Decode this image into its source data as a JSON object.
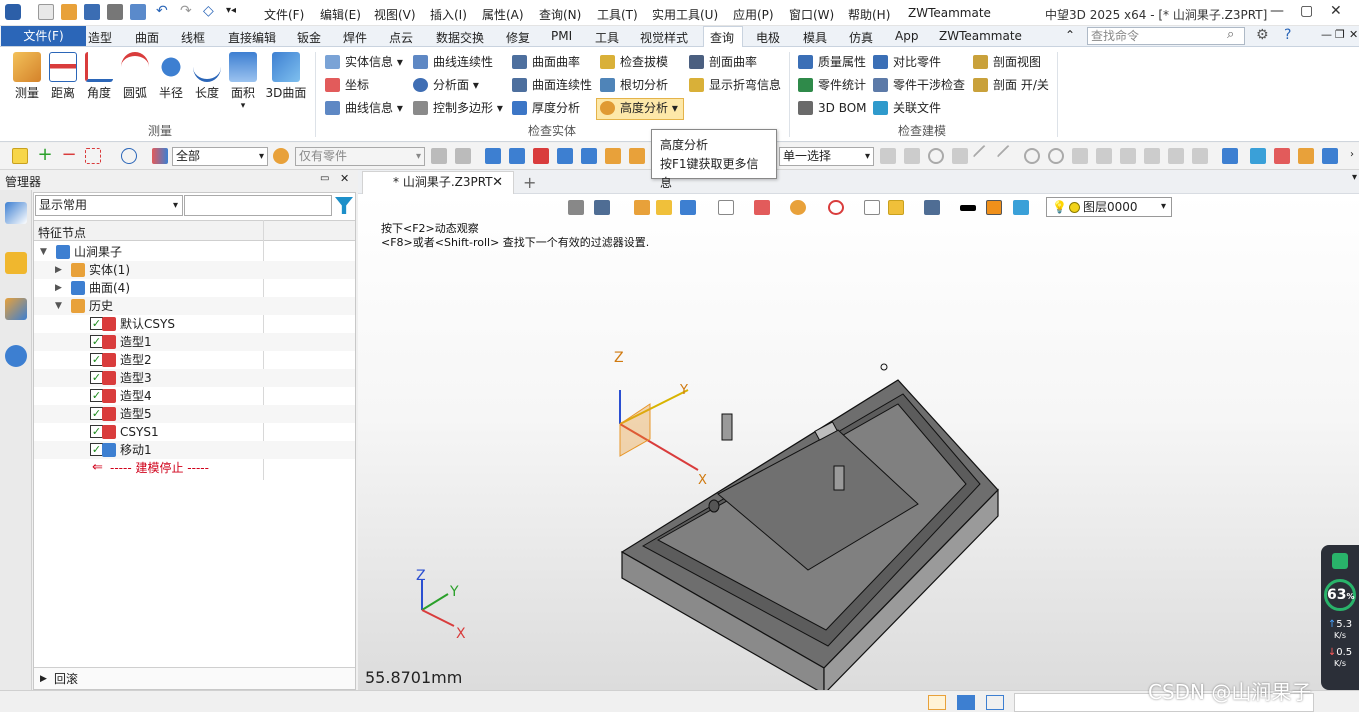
{
  "menu": [
    "文件(F)",
    "编辑(E)",
    "视图(V)",
    "插入(I)",
    "属性(A)",
    "查询(N)",
    "工具(T)",
    "实用工具(U)",
    "应用(P)",
    "窗口(W)",
    "帮助(H)",
    "ZWTeammate"
  ],
  "window_title": "中望3D 2025 x64 - [* 山涧果子.Z3PRT]",
  "ribbon_tabs": [
    "文件(F)",
    "造型",
    "曲面",
    "线框",
    "直接编辑",
    "钣金",
    "焊件",
    "点云",
    "数据交换",
    "修复",
    "PMI",
    "工具",
    "视觉样式",
    "查询",
    "电极",
    "模具",
    "仿真",
    "App",
    "ZWTeammate"
  ],
  "search_placeholder": "查找命令",
  "measure_group": {
    "title": "测量",
    "buttons": [
      "测量",
      "距离",
      "角度",
      "圆弧",
      "半径",
      "长度",
      "面积",
      "3D曲面"
    ]
  },
  "inspect_group": {
    "title": "检查实体",
    "items": [
      "实体信息",
      "坐标",
      "曲线信息",
      "曲线连续性",
      "分析面",
      "控制多边形",
      "曲面曲率",
      "曲面连续性",
      "厚度分析",
      "检查拔模",
      "根切分析",
      "高度分析",
      "剖面曲率",
      "显示折弯信息"
    ]
  },
  "model_group": {
    "title": "检查建模",
    "items": [
      "质量属性",
      "零件统计",
      "3D BOM",
      "对比零件",
      "零件干涉检查",
      "关联文件",
      "剖面视图",
      "剖面 开/关"
    ]
  },
  "tooltip": {
    "title": "高度分析",
    "body": "按F1键获取更多信息"
  },
  "toolbar2": {
    "filter_all": "全部",
    "part_only": "仅有零件",
    "select_mode": "单一选择"
  },
  "manager": {
    "title": "管理器",
    "filter": "显示常用",
    "col_header": "特征节点",
    "rollback": "回滚"
  },
  "tree": [
    {
      "label": "山涧果子",
      "level": 0,
      "toggle": "v"
    },
    {
      "label": "实体(1)",
      "level": 1,
      "toggle": ">"
    },
    {
      "label": "曲面(4)",
      "level": 1,
      "toggle": ">"
    },
    {
      "label": "历史",
      "level": 1,
      "toggle": "v"
    },
    {
      "label": "默认CSYS",
      "level": 2,
      "check": true
    },
    {
      "label": "造型1",
      "level": 2,
      "check": true
    },
    {
      "label": "造型2",
      "level": 2,
      "check": true
    },
    {
      "label": "造型3",
      "level": 2,
      "check": true
    },
    {
      "label": "造型4",
      "level": 2,
      "check": true
    },
    {
      "label": "造型5",
      "level": 2,
      "check": true
    },
    {
      "label": "CSYS1",
      "level": 2,
      "check": true
    },
    {
      "label": "移动1",
      "level": 2,
      "check": true
    },
    {
      "label": "----- 建模停止 -----",
      "level": 2,
      "stop": true
    }
  ],
  "doc_tab": "* 山涧果子.Z3PRT",
  "viewport": {
    "hint1": "按下<F2>动态观察",
    "hint2": "<F8>或者<Shift-roll> 查找下一个有效的过滤器设置.",
    "measure": "55.8701mm",
    "layer": "图层0000",
    "axis_x": "X",
    "axis_y": "Y",
    "axis_z": "Z"
  },
  "gauge": {
    "percent": "63",
    "pct_sign": "%",
    "up": "5.3",
    "up_unit": "K/s",
    "down": "0.5",
    "down_unit": "K/s"
  },
  "watermark": "CSDN @山涧果子",
  "colors": {
    "accent": "#2b66b8",
    "highlight": "#fde8a9",
    "stop": "#d0021b",
    "check": "#1b8a1b"
  }
}
